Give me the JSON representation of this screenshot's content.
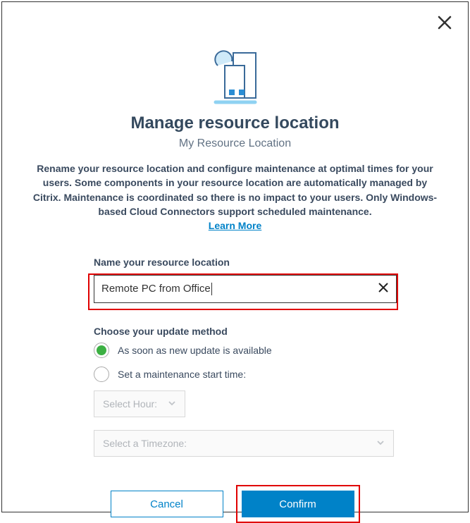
{
  "dialog": {
    "title": "Manage resource location",
    "subtitle": "My Resource Location",
    "description": "Rename your resource location and configure maintenance at optimal times for your users. Some components in your resource location are automatically managed by Citrix. Maintenance is coordinated so there is no impact to your users. Only Windows-based Cloud Connectors support scheduled maintenance.",
    "learn_more": "Learn More"
  },
  "form": {
    "name_label": "Name your resource location",
    "name_value": "Remote PC from Office",
    "update_label": "Choose your update method",
    "options": [
      {
        "label": "As soon as new update is available",
        "selected": true
      },
      {
        "label": "Set a maintenance start time:",
        "selected": false
      }
    ],
    "select_hour_placeholder": "Select Hour:",
    "select_tz_placeholder": "Select a Timezone:"
  },
  "buttons": {
    "cancel": "Cancel",
    "confirm": "Confirm"
  },
  "colors": {
    "accent": "#0082c8",
    "highlight_border": "#e00000",
    "radio_selected": "#3cb043"
  }
}
